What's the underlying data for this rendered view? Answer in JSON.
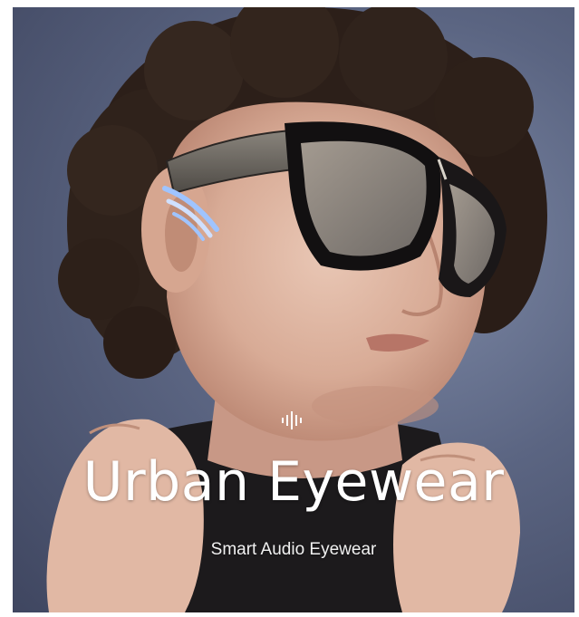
{
  "banner": {
    "headline": "Urban Eyewear",
    "subtitle": "Smart Audio Eyewear",
    "icon": "sound-wave-icon"
  },
  "colors": {
    "background": "#5b6582",
    "text": "#ffffff",
    "led_glow": "#9fc4ff"
  }
}
